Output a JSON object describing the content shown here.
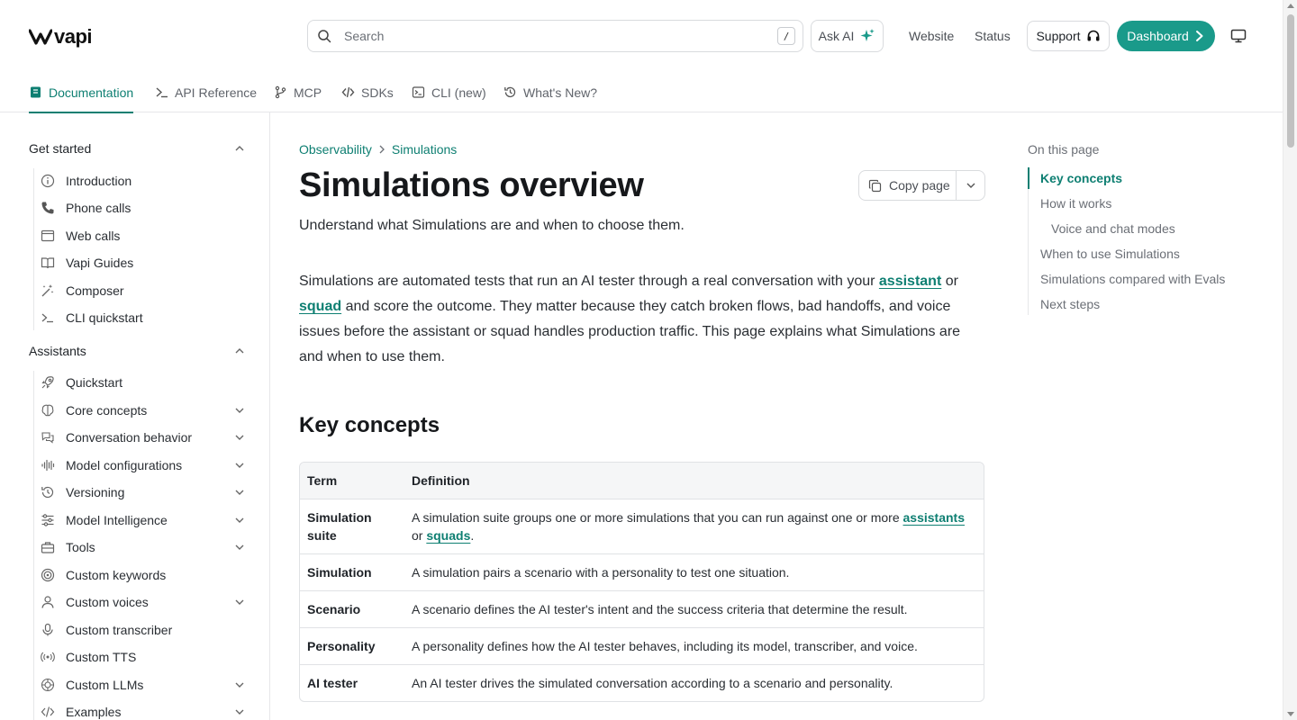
{
  "brand": {
    "name": "vapi",
    "accent": "#1a9a8a",
    "link": "#0e7f72"
  },
  "header": {
    "search_placeholder": "Search",
    "search_shortcut": "/",
    "ask_ai": "Ask AI",
    "links": [
      "Website",
      "Status"
    ],
    "support": "Support",
    "dashboard": "Dashboard"
  },
  "tabs": [
    {
      "label": "Documentation",
      "icon": "book-icon",
      "active": true
    },
    {
      "label": "API Reference",
      "icon": "terminal-icon"
    },
    {
      "label": "MCP",
      "icon": "git-branch-icon"
    },
    {
      "label": "SDKs",
      "icon": "code-icon"
    },
    {
      "label": "CLI (new)",
      "icon": "terminal-square-icon"
    },
    {
      "label": "What's New?",
      "icon": "history-icon"
    }
  ],
  "sidebar": {
    "sections": [
      {
        "title": "Get started",
        "items": [
          {
            "label": "Introduction",
            "icon": "info-icon"
          },
          {
            "label": "Phone calls",
            "icon": "phone-icon"
          },
          {
            "label": "Web calls",
            "icon": "browser-icon"
          },
          {
            "label": "Vapi Guides",
            "icon": "book-open-icon"
          },
          {
            "label": "Composer",
            "icon": "magic-wand-icon"
          },
          {
            "label": "CLI quickstart",
            "icon": "terminal-icon"
          }
        ]
      },
      {
        "title": "Assistants",
        "items": [
          {
            "label": "Quickstart",
            "icon": "rocket-icon"
          },
          {
            "label": "Core concepts",
            "icon": "brain-icon",
            "expandable": true
          },
          {
            "label": "Conversation behavior",
            "icon": "chat-icon",
            "expandable": true
          },
          {
            "label": "Model configurations",
            "icon": "waveform-icon",
            "expandable": true
          },
          {
            "label": "Versioning",
            "icon": "history-icon",
            "expandable": true
          },
          {
            "label": "Model Intelligence",
            "icon": "sliders-icon",
            "expandable": true
          },
          {
            "label": "Tools",
            "icon": "toolbox-icon",
            "expandable": true
          },
          {
            "label": "Custom keywords",
            "icon": "target-icon"
          },
          {
            "label": "Custom voices",
            "icon": "user-icon",
            "expandable": true
          },
          {
            "label": "Custom transcriber",
            "icon": "microphone-icon"
          },
          {
            "label": "Custom TTS",
            "icon": "speaker-icon"
          },
          {
            "label": "Custom LLMs",
            "icon": "brain-circuit-icon",
            "expandable": true
          },
          {
            "label": "Examples",
            "icon": "code-icon",
            "expandable": true
          }
        ]
      }
    ]
  },
  "breadcrumb": [
    "Observability",
    "Simulations"
  ],
  "page": {
    "title": "Simulations overview",
    "copy_page": "Copy page",
    "subtitle": "Understand what Simulations are and when to choose them.",
    "intro": {
      "p1": "Simulations are automated tests that run an AI tester through a real conversation with your ",
      "link1": "assistant",
      "p2": " or ",
      "link2": "squad",
      "p3": " and score the outcome. They matter because they catch broken flows, bad handoffs, and voice issues before the assistant or squad handles production traffic. This page explains what Simulations are and when to use them."
    },
    "section_heading": "Key concepts"
  },
  "table": {
    "headers": [
      "Term",
      "Definition"
    ],
    "rows": [
      {
        "term": "Simulation suite",
        "def_pre": "A simulation suite groups one or more simulations that you can run against one or more ",
        "def_link1": "assistants",
        "def_mid": " or ",
        "def_link2": "squads",
        "def_post": "."
      },
      {
        "term": "Simulation",
        "def": "A simulation pairs a scenario with a personality to test one situation."
      },
      {
        "term": "Scenario",
        "def": "A scenario defines the AI tester's intent and the success criteria that determine the result."
      },
      {
        "term": "Personality",
        "def": "A personality defines how the AI tester behaves, including its model, transcriber, and voice."
      },
      {
        "term": "AI tester",
        "def": "An AI tester drives the simulated conversation according to a scenario and personality."
      }
    ]
  },
  "toc": {
    "title": "On this page",
    "items": [
      {
        "label": "Key concepts",
        "active": true
      },
      {
        "label": "How it works"
      },
      {
        "label": "Voice and chat modes",
        "nested": true
      },
      {
        "label": "When to use Simulations"
      },
      {
        "label": "Simulations compared with Evals"
      },
      {
        "label": "Next steps"
      }
    ]
  }
}
